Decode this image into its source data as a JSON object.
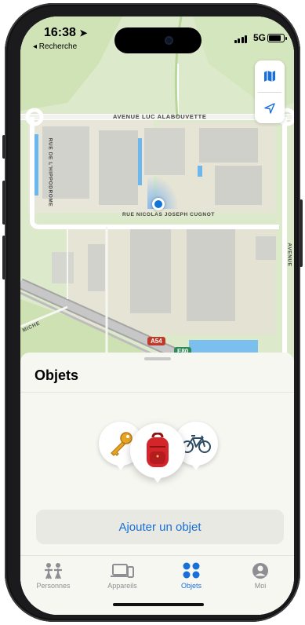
{
  "status_bar": {
    "time": "16:38",
    "back_label": "◂ Recherche",
    "network": "5G",
    "battery_level": 0.85
  },
  "map": {
    "streets": {
      "avenue_top": "AVENUE LUC ALABOUVETTE",
      "rue_left": "RUE DE L'HIPPODROME",
      "rue_middle": "RUE NICOLAS JOSEPH CUGNOT",
      "avenue_right": "AVENUE",
      "bottom_left": "MICHE"
    },
    "road_shield_red": "A54",
    "road_shield_green": "E80",
    "controls": {
      "map_mode_icon": "map-icon",
      "locate_icon": "location-arrow-icon"
    }
  },
  "sheet": {
    "title": "Objets",
    "items": [
      {
        "icon": "key-icon",
        "label": "key"
      },
      {
        "icon": "backpack-icon",
        "label": "backpack"
      },
      {
        "icon": "bicycle-icon",
        "label": "bicycle"
      }
    ],
    "add_button": "Ajouter un objet"
  },
  "tabbar": {
    "tabs": [
      {
        "label": "Personnes",
        "icon": "people-icon",
        "active": false
      },
      {
        "label": "Appareils",
        "icon": "devices-icon",
        "active": false
      },
      {
        "label": "Objets",
        "icon": "items-grid-icon",
        "active": true
      },
      {
        "label": "Moi",
        "icon": "person-circle-icon",
        "active": false
      }
    ]
  },
  "colors": {
    "accent": "#1a6fd6",
    "map_land": "#dfeccf",
    "user_location": "#1273d8"
  }
}
